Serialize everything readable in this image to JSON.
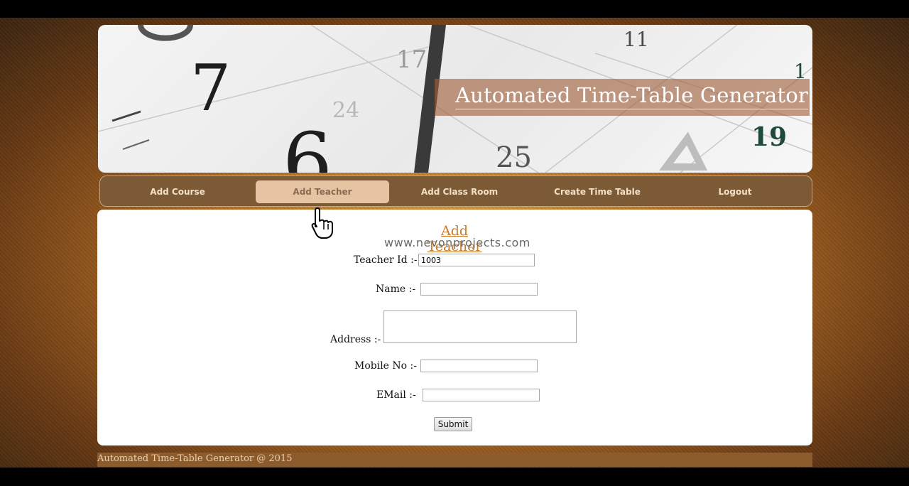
{
  "banner": {
    "title": "Automated Time-Table Generator"
  },
  "nav": {
    "items": [
      {
        "label": "Add Course"
      },
      {
        "label": "Add Teacher",
        "active": true
      },
      {
        "label": "Add Class Room"
      },
      {
        "label": "Create Time Table"
      },
      {
        "label": "Logout"
      }
    ]
  },
  "form": {
    "title": "Add Teacher",
    "watermark": "www.nevonprojects.com",
    "fields": {
      "teacher_id": {
        "label": "Teacher Id :-",
        "value": "1003"
      },
      "name": {
        "label": "Name :-",
        "value": ""
      },
      "address": {
        "label": "Address :-",
        "value": ""
      },
      "mobile": {
        "label": "Mobile No :-",
        "value": ""
      },
      "email": {
        "label": "EMail :-",
        "value": ""
      }
    },
    "submit_label": "Submit"
  },
  "footer": {
    "text": "Automated Time-Table Generator @  2015"
  },
  "icons": {
    "cursor": "hand-pointer-icon"
  }
}
